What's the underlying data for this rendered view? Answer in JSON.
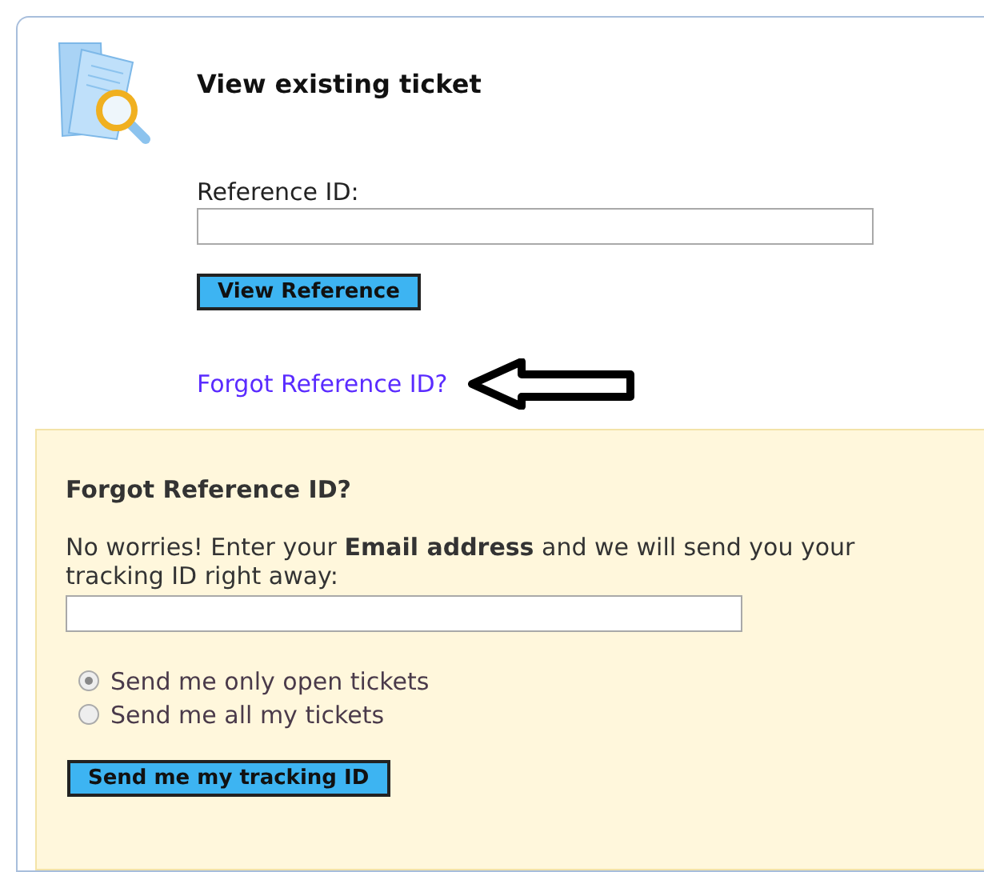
{
  "view_ticket": {
    "title": "View existing ticket",
    "reference_label": "Reference ID:",
    "button": "View Reference",
    "forgot_link": "Forgot Reference ID?"
  },
  "forgot_panel": {
    "title": "Forgot Reference ID?",
    "description": "No worries! Enter your **Email address** and we will send you your tracking ID right away:",
    "options": [
      {
        "label": "Send me only open tickets",
        "selected": true
      },
      {
        "label": "Send me all my tickets",
        "selected": false
      }
    ],
    "button": "Send me my tracking ID"
  }
}
